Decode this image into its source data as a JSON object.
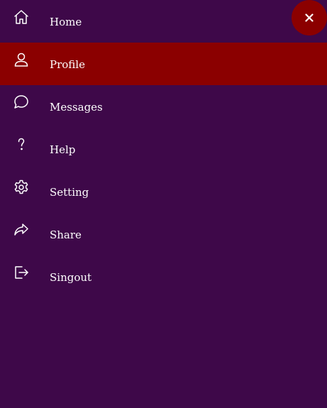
{
  "colors": {
    "background": "#3e0849",
    "active": "#8b0000",
    "text": "#ffffff"
  },
  "menu": {
    "items": [
      {
        "label": "Home",
        "icon": "home-icon",
        "active": false
      },
      {
        "label": "Profile",
        "icon": "user-icon",
        "active": true
      },
      {
        "label": "Messages",
        "icon": "chat-icon",
        "active": false
      },
      {
        "label": "Help",
        "icon": "question-icon",
        "active": false
      },
      {
        "label": "Setting",
        "icon": "gear-icon",
        "active": false
      },
      {
        "label": "Share",
        "icon": "share-icon",
        "active": false
      },
      {
        "label": "Singout",
        "icon": "logout-icon",
        "active": false
      }
    ]
  },
  "close_button": {
    "icon": "close-icon"
  }
}
